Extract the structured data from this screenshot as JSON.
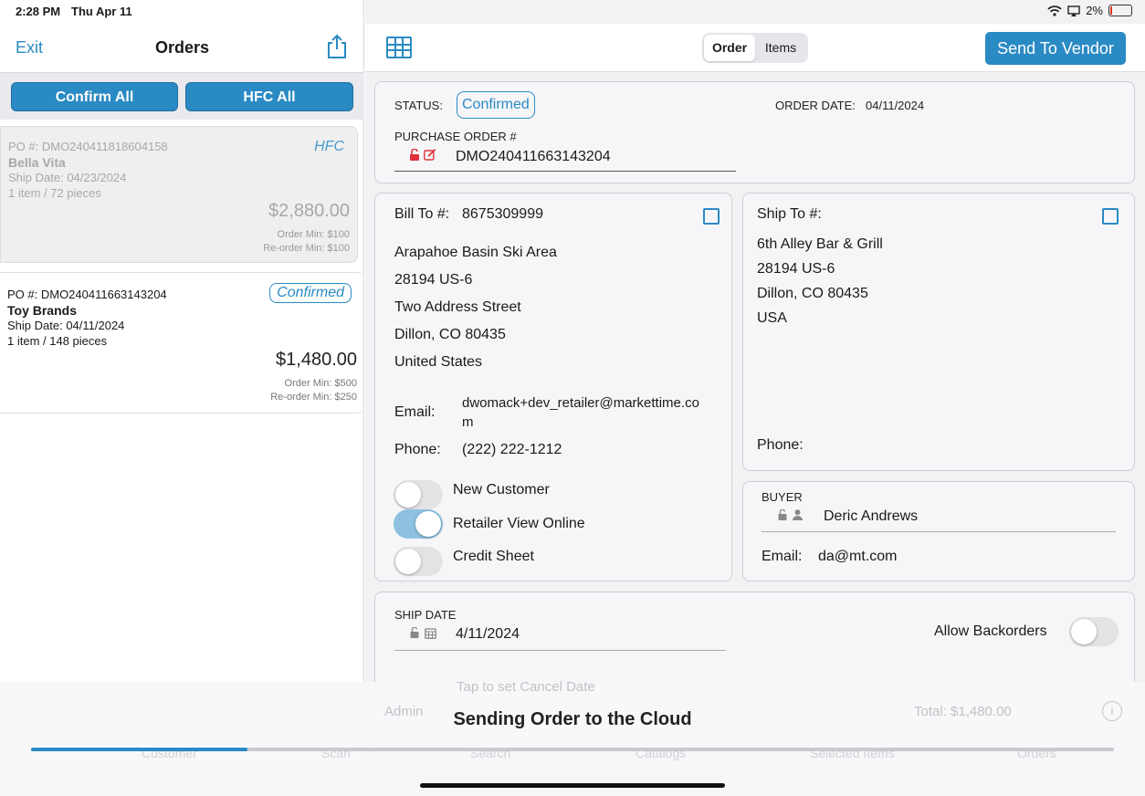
{
  "status_bar": {
    "time": "2:28 PM",
    "date": "Thu Apr 11",
    "battery": "2%"
  },
  "left": {
    "exit_label": "Exit",
    "title": "Orders",
    "confirm_all": "Confirm All",
    "hfc_all": "HFC All",
    "orders": [
      {
        "po": "PO #: DMO240411818604158",
        "vendor": "Bella Vita",
        "ship_date": "Ship Date: 04/23/2024",
        "items": "1 item / 72 pieces",
        "tag": "HFC",
        "amount": "$2,880.00",
        "order_min": "Order Min: $100",
        "reorder_min": "Re-order Min: $100"
      },
      {
        "po": "PO #: DMO240411663143204",
        "vendor": "Toy Brands",
        "ship_date": "Ship Date: 04/11/2024",
        "items": "1 item / 148 pieces",
        "tag": "Confirmed",
        "amount": "$1,480.00",
        "order_min": "Order Min: $500",
        "reorder_min": "Re-order Min: $250"
      }
    ]
  },
  "right": {
    "tabs": [
      "Order",
      "Items"
    ],
    "send_label": "Send To Vendor",
    "status_label": "STATUS:",
    "status_value": "Confirmed",
    "order_date_label": "ORDER DATE:",
    "order_date_value": "04/11/2024",
    "po_label": "PURCHASE ORDER #",
    "po_value": "DMO240411663143204",
    "bill_to": {
      "label": "Bill To #:",
      "number": "8675309999",
      "lines": [
        "Arapahoe Basin Ski Area",
        "28194 US-6",
        "Two Address Street",
        "Dillon, CO  80435",
        "United States"
      ],
      "email_label": "Email:",
      "email_l1": "dwomack+dev_retailer@markettime.co",
      "email_l2": "m",
      "phone_label": "Phone:",
      "phone": "(222) 222-1212",
      "toggles": [
        {
          "label": "New Customer",
          "on": false
        },
        {
          "label": "Retailer View Online",
          "on": true
        },
        {
          "label": "Credit Sheet",
          "on": false
        }
      ]
    },
    "ship_to": {
      "label": "Ship To #:",
      "lines": [
        "6th Alley Bar & Grill",
        "28194 US-6",
        "Dillon, CO  80435",
        "USA"
      ],
      "phone_label": "Phone:"
    },
    "buyer": {
      "label": "BUYER",
      "name": "Deric Andrews",
      "email_label": "Email:",
      "email": "da@mt.com"
    },
    "ship_date_label": "SHIP DATE",
    "ship_date_value": "4/11/2024",
    "allow_backorders": "Allow Backorders",
    "cancel_date_placeholder": "Tap to set Cancel Date",
    "footer_left": "Admin",
    "total": "Total:  $1,480.00"
  },
  "overlay": {
    "message": "Sending Order to the Cloud",
    "progress_fraction": 0.2
  },
  "tab_bar": [
    "Customer",
    "Scan",
    "Search",
    "Catalogs",
    "Selected Items",
    "Orders"
  ],
  "colors": {
    "accent": "#2a8ac4",
    "danger": "#e0303a"
  }
}
